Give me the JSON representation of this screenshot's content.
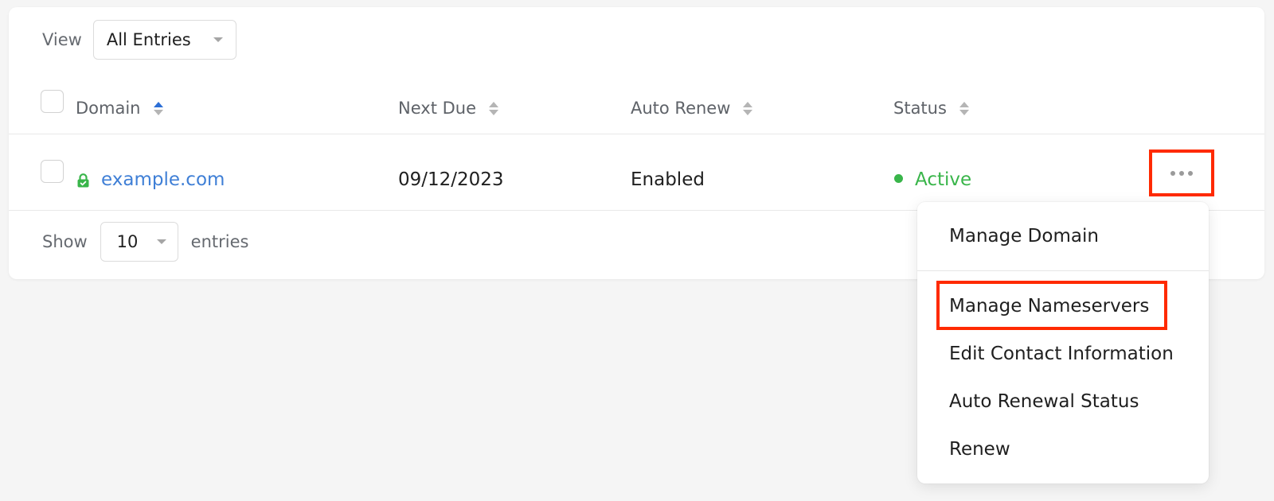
{
  "toolbar": {
    "view_label": "View",
    "view_select_value": "All Entries"
  },
  "table": {
    "columns": [
      "Domain",
      "Next Due",
      "Auto Renew",
      "Status"
    ],
    "rows": [
      {
        "domain": "example.com",
        "next_due": "09/12/2023",
        "auto_renew": "Enabled",
        "status": "Active"
      }
    ]
  },
  "footer": {
    "show_label": "Show",
    "entries_value": "10",
    "entries_label": "entries"
  },
  "actions_menu": {
    "items": [
      "Manage Domain",
      "Manage Nameservers",
      "Edit Contact Information",
      "Auto Renewal Status",
      "Renew"
    ]
  },
  "colors": {
    "link": "#3f7fd6",
    "active": "#39b54a",
    "sort_active": "#2d6fd6",
    "annotation": "#ff2a00"
  },
  "icons": {
    "lock": "lock-icon",
    "more": "more-actions-icon",
    "sort": "sort-icon",
    "dropdown": "chevron-down-icon"
  }
}
